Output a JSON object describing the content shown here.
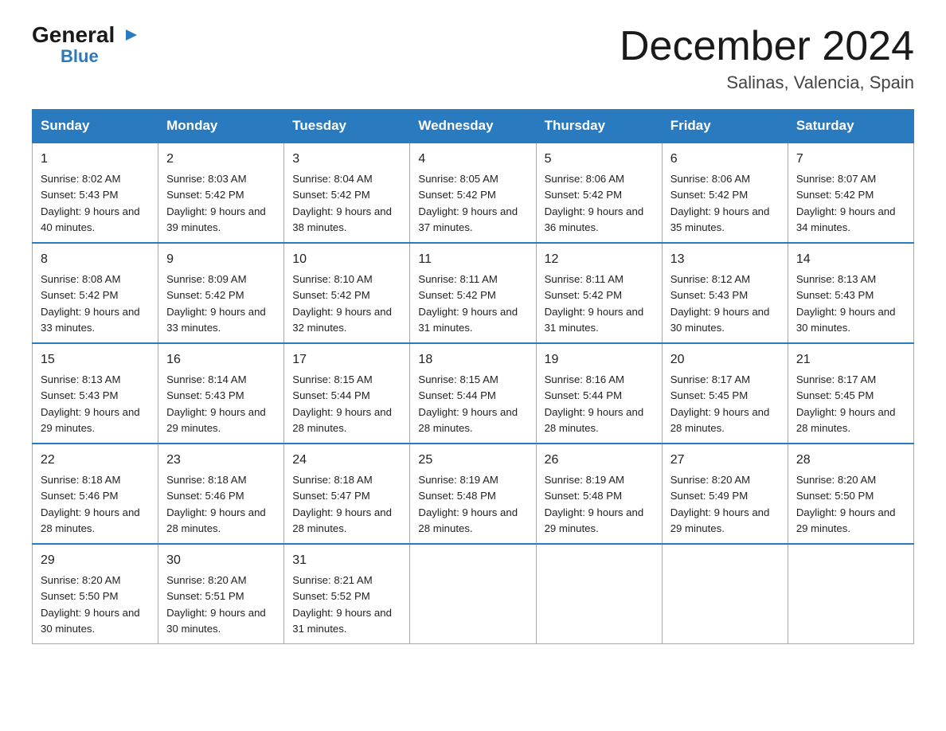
{
  "logo": {
    "general": "General",
    "arrow": "▶",
    "blue": "Blue"
  },
  "header": {
    "title": "December 2024",
    "subtitle": "Salinas, Valencia, Spain"
  },
  "weekdays": [
    "Sunday",
    "Monday",
    "Tuesday",
    "Wednesday",
    "Thursday",
    "Friday",
    "Saturday"
  ],
  "weeks": [
    [
      {
        "day": "1",
        "sunrise": "8:02 AM",
        "sunset": "5:43 PM",
        "daylight": "9 hours and 40 minutes."
      },
      {
        "day": "2",
        "sunrise": "8:03 AM",
        "sunset": "5:42 PM",
        "daylight": "9 hours and 39 minutes."
      },
      {
        "day": "3",
        "sunrise": "8:04 AM",
        "sunset": "5:42 PM",
        "daylight": "9 hours and 38 minutes."
      },
      {
        "day": "4",
        "sunrise": "8:05 AM",
        "sunset": "5:42 PM",
        "daylight": "9 hours and 37 minutes."
      },
      {
        "day": "5",
        "sunrise": "8:06 AM",
        "sunset": "5:42 PM",
        "daylight": "9 hours and 36 minutes."
      },
      {
        "day": "6",
        "sunrise": "8:06 AM",
        "sunset": "5:42 PM",
        "daylight": "9 hours and 35 minutes."
      },
      {
        "day": "7",
        "sunrise": "8:07 AM",
        "sunset": "5:42 PM",
        "daylight": "9 hours and 34 minutes."
      }
    ],
    [
      {
        "day": "8",
        "sunrise": "8:08 AM",
        "sunset": "5:42 PM",
        "daylight": "9 hours and 33 minutes."
      },
      {
        "day": "9",
        "sunrise": "8:09 AM",
        "sunset": "5:42 PM",
        "daylight": "9 hours and 33 minutes."
      },
      {
        "day": "10",
        "sunrise": "8:10 AM",
        "sunset": "5:42 PM",
        "daylight": "9 hours and 32 minutes."
      },
      {
        "day": "11",
        "sunrise": "8:11 AM",
        "sunset": "5:42 PM",
        "daylight": "9 hours and 31 minutes."
      },
      {
        "day": "12",
        "sunrise": "8:11 AM",
        "sunset": "5:42 PM",
        "daylight": "9 hours and 31 minutes."
      },
      {
        "day": "13",
        "sunrise": "8:12 AM",
        "sunset": "5:43 PM",
        "daylight": "9 hours and 30 minutes."
      },
      {
        "day": "14",
        "sunrise": "8:13 AM",
        "sunset": "5:43 PM",
        "daylight": "9 hours and 30 minutes."
      }
    ],
    [
      {
        "day": "15",
        "sunrise": "8:13 AM",
        "sunset": "5:43 PM",
        "daylight": "9 hours and 29 minutes."
      },
      {
        "day": "16",
        "sunrise": "8:14 AM",
        "sunset": "5:43 PM",
        "daylight": "9 hours and 29 minutes."
      },
      {
        "day": "17",
        "sunrise": "8:15 AM",
        "sunset": "5:44 PM",
        "daylight": "9 hours and 28 minutes."
      },
      {
        "day": "18",
        "sunrise": "8:15 AM",
        "sunset": "5:44 PM",
        "daylight": "9 hours and 28 minutes."
      },
      {
        "day": "19",
        "sunrise": "8:16 AM",
        "sunset": "5:44 PM",
        "daylight": "9 hours and 28 minutes."
      },
      {
        "day": "20",
        "sunrise": "8:17 AM",
        "sunset": "5:45 PM",
        "daylight": "9 hours and 28 minutes."
      },
      {
        "day": "21",
        "sunrise": "8:17 AM",
        "sunset": "5:45 PM",
        "daylight": "9 hours and 28 minutes."
      }
    ],
    [
      {
        "day": "22",
        "sunrise": "8:18 AM",
        "sunset": "5:46 PM",
        "daylight": "9 hours and 28 minutes."
      },
      {
        "day": "23",
        "sunrise": "8:18 AM",
        "sunset": "5:46 PM",
        "daylight": "9 hours and 28 minutes."
      },
      {
        "day": "24",
        "sunrise": "8:18 AM",
        "sunset": "5:47 PM",
        "daylight": "9 hours and 28 minutes."
      },
      {
        "day": "25",
        "sunrise": "8:19 AM",
        "sunset": "5:48 PM",
        "daylight": "9 hours and 28 minutes."
      },
      {
        "day": "26",
        "sunrise": "8:19 AM",
        "sunset": "5:48 PM",
        "daylight": "9 hours and 29 minutes."
      },
      {
        "day": "27",
        "sunrise": "8:20 AM",
        "sunset": "5:49 PM",
        "daylight": "9 hours and 29 minutes."
      },
      {
        "day": "28",
        "sunrise": "8:20 AM",
        "sunset": "5:50 PM",
        "daylight": "9 hours and 29 minutes."
      }
    ],
    [
      {
        "day": "29",
        "sunrise": "8:20 AM",
        "sunset": "5:50 PM",
        "daylight": "9 hours and 30 minutes."
      },
      {
        "day": "30",
        "sunrise": "8:20 AM",
        "sunset": "5:51 PM",
        "daylight": "9 hours and 30 minutes."
      },
      {
        "day": "31",
        "sunrise": "8:21 AM",
        "sunset": "5:52 PM",
        "daylight": "9 hours and 31 minutes."
      },
      null,
      null,
      null,
      null
    ]
  ]
}
